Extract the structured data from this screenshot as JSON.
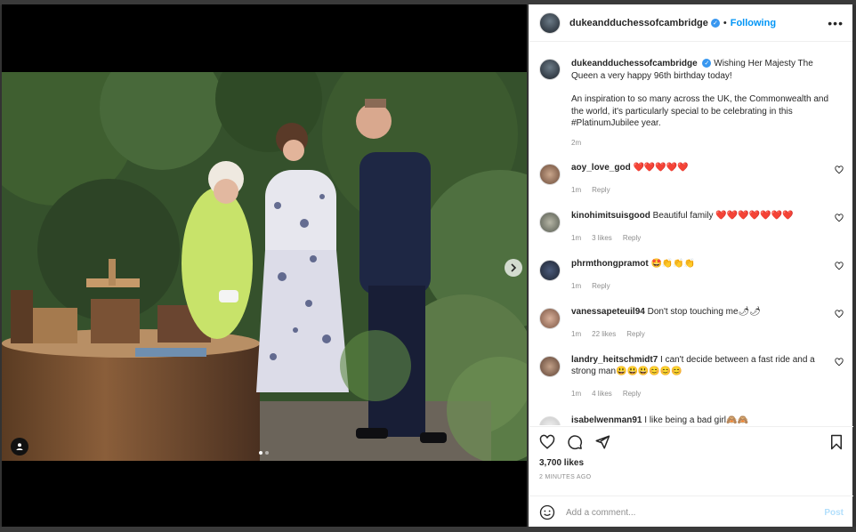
{
  "header": {
    "username": "dukeandduchessofcambridge",
    "follow_label": "Following",
    "more_label": "•••"
  },
  "caption": {
    "username": "dukeandduchessofcambridge",
    "line1": "Wishing Her Majesty The Queen a very happy 96th birthday today!",
    "line2": "An inspiration to so many across the UK, the Commonwealth and the world, it's particularly special to be celebrating in this #PlatinumJubilee year.",
    "time": "2m"
  },
  "comments": [
    {
      "username": "aoy_love_god",
      "text": "❤️❤️❤️❤️❤️",
      "time": "1m",
      "likes": "",
      "reply": "Reply"
    },
    {
      "username": "kinohimitsuisgood",
      "text": "Beautiful family ❤️❤️❤️❤️❤️❤️❤️",
      "time": "1m",
      "likes": "3 likes",
      "reply": "Reply"
    },
    {
      "username": "phrmthongpramot",
      "text": "🤩👏👏👏",
      "time": "1m",
      "likes": "",
      "reply": "Reply"
    },
    {
      "username": "vanessapeteuil94",
      "text": "Don't stop touching me🌶🌶",
      "time": "1m",
      "likes": "22 likes",
      "reply": "Reply"
    },
    {
      "username": "landry_heitschmidt7",
      "text": "I can't decide between a fast ride and a strong man😃😃😃😊😊😊",
      "time": "1m",
      "likes": "4 likes",
      "reply": "Reply"
    },
    {
      "username": "isabelwenman91",
      "text": "I like being a bad girl🙈🙈",
      "time": "",
      "likes": "",
      "reply": ""
    }
  ],
  "actions": {
    "likes": "3,700 likes",
    "time_ago": "2 MINUTES AGO"
  },
  "comment_box": {
    "placeholder": "Add a comment...",
    "post_label": "Post"
  },
  "icons": {
    "like": "heart-icon",
    "comment": "comment-icon",
    "share": "share-icon",
    "save": "bookmark-icon",
    "emoji": "emoji-icon",
    "next": "chevron-right-icon",
    "tags": "user-tag-icon"
  },
  "colors": {
    "link_blue": "#0095f6",
    "verified_blue": "#3897f0",
    "heart_red": "#e0245e",
    "muted_text": "#8e8e8e",
    "coat_green": "#c8e36a"
  }
}
